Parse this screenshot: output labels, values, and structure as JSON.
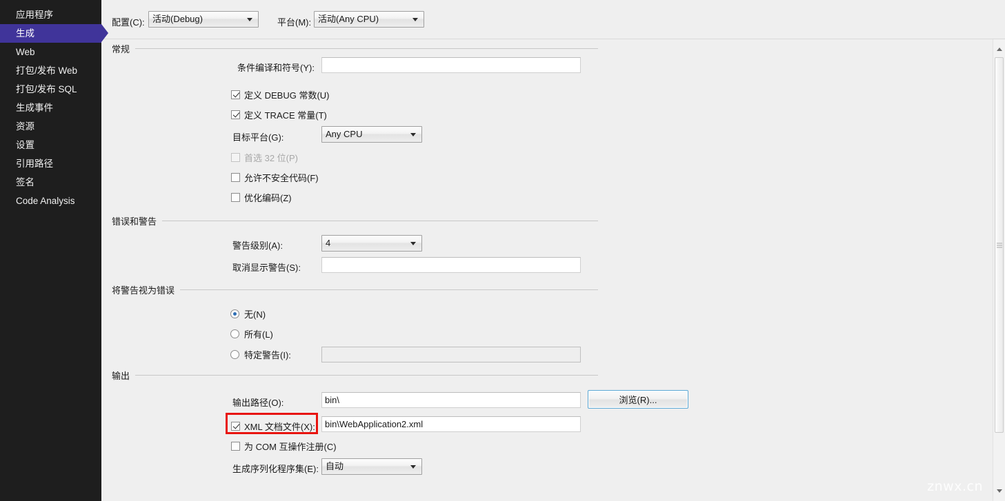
{
  "sidebar": {
    "items": [
      {
        "label": "应用程序",
        "selected": false
      },
      {
        "label": "生成",
        "selected": true
      },
      {
        "label": "Web",
        "selected": false
      },
      {
        "label": "打包/发布 Web",
        "selected": false
      },
      {
        "label": "打包/发布 SQL",
        "selected": false
      },
      {
        "label": "生成事件",
        "selected": false
      },
      {
        "label": "资源",
        "selected": false
      },
      {
        "label": "设置",
        "selected": false
      },
      {
        "label": "引用路径",
        "selected": false
      },
      {
        "label": "签名",
        "selected": false
      },
      {
        "label": "Code Analysis",
        "selected": false
      }
    ]
  },
  "configbar": {
    "config_label": "配置(C):",
    "config_value": "活动(Debug)",
    "platform_label": "平台(M):",
    "platform_value": "活动(Any CPU)"
  },
  "general": {
    "title": "常规",
    "conditional_label": "条件编译和符号(Y):",
    "conditional_value": "",
    "define_debug_label": "定义 DEBUG 常数(U)",
    "define_debug_checked": true,
    "define_trace_label": "定义 TRACE 常量(T)",
    "define_trace_checked": true,
    "target_platform_label": "目标平台(G):",
    "target_platform_value": "Any CPU",
    "prefer32_label": "首选 32 位(P)",
    "prefer32_checked": false,
    "prefer32_disabled": true,
    "unsafe_label": "允许不安全代码(F)",
    "unsafe_checked": false,
    "optimize_label": "优化编码(Z)",
    "optimize_checked": false
  },
  "errors": {
    "title": "错误和警告",
    "warn_level_label": "警告级别(A):",
    "warn_level_value": "4",
    "suppress_label": "取消显示警告(S):",
    "suppress_value": ""
  },
  "warnings_as_errors": {
    "title": "将警告视为错误",
    "none_label": "无(N)",
    "none_selected": true,
    "all_label": "所有(L)",
    "all_selected": false,
    "specific_label": "特定警告(I):",
    "specific_selected": false,
    "specific_value": ""
  },
  "output": {
    "title": "输出",
    "path_label": "输出路径(O):",
    "path_value": "bin\\",
    "browse_label": "浏览(R)...",
    "xml_doc_label": "XML 文档文件(X):",
    "xml_doc_checked": true,
    "xml_doc_value": "bin\\WebApplication2.xml",
    "com_interop_label": "为 COM 互操作注册(C)",
    "com_interop_checked": false,
    "serialization_label": "生成序列化程序集(E):",
    "serialization_value": "自动"
  },
  "watermark": {
    "text": "znwx.cn"
  },
  "colors": {
    "sidebar_bg": "#1e1e1e",
    "selection": "#40349a",
    "content_bg": "#efefef",
    "annotation": "#e8140f",
    "focus_border": "#5ba7d4"
  }
}
